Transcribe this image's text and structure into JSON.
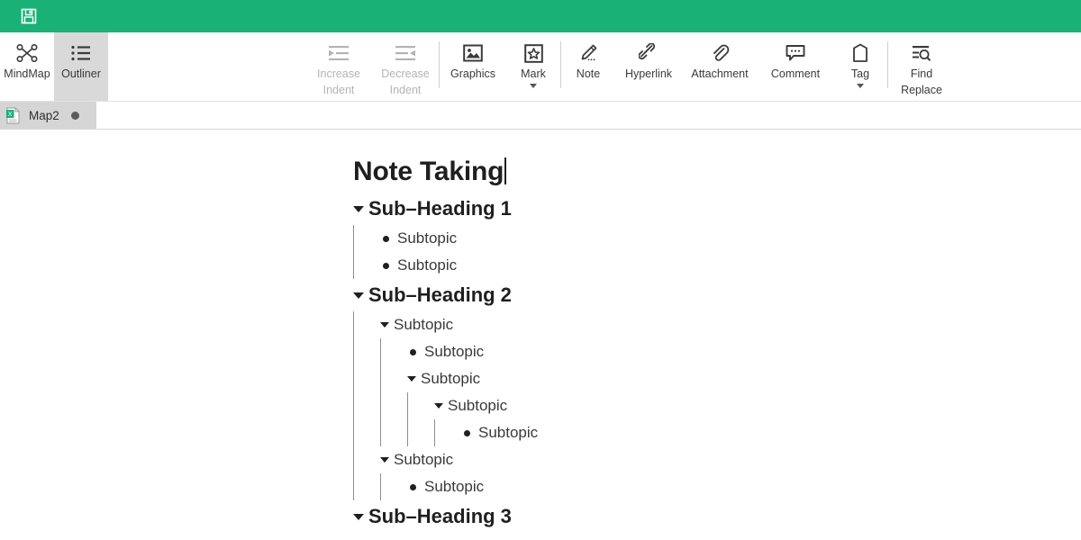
{
  "titlebar": {
    "save_label": "Save",
    "save_icon": "floppy-disk-icon",
    "background_color": "#1ab176"
  },
  "toolbar": {
    "view_buttons": [
      {
        "label": "MindMap",
        "icon": "mindmap-icon",
        "selected": false,
        "disabled": false
      },
      {
        "label": "Outliner",
        "icon": "outliner-list-icon",
        "selected": true,
        "disabled": false
      }
    ],
    "indent_buttons": [
      {
        "label_line1": "Increase",
        "label_line2": "Indent",
        "icon": "increase-indent-icon",
        "disabled": true
      },
      {
        "label_line1": "Decrease",
        "label_line2": "Indent",
        "icon": "decrease-indent-icon",
        "disabled": true
      }
    ],
    "insert_buttons": [
      {
        "label": "Graphics",
        "icon": "image-icon",
        "has_dropdown": false
      },
      {
        "label": "Mark",
        "icon": "star-badge-icon",
        "has_dropdown": true
      }
    ],
    "annotate_buttons": [
      {
        "label": "Note",
        "icon": "pencil-note-icon",
        "has_dropdown": false
      },
      {
        "label": "Hyperlink",
        "icon": "link-chain-icon",
        "has_dropdown": false
      },
      {
        "label": "Attachment",
        "icon": "paperclip-icon",
        "has_dropdown": false
      },
      {
        "label": "Comment",
        "icon": "comment-bubble-icon",
        "has_dropdown": false
      },
      {
        "label": "Tag",
        "icon": "tag-icon",
        "has_dropdown": true
      }
    ],
    "find_button": {
      "label_line1": "Find",
      "label_line2": "Replace",
      "icon": "find-replace-icon"
    },
    "selected_background": "#d9d9d9",
    "disabled_color": "#b4b4b4"
  },
  "tabbar": {
    "tabs": [
      {
        "title": "Map2",
        "icon": "map-document-icon",
        "modified": true,
        "active": true
      }
    ]
  },
  "outline": {
    "title": "Note Taking",
    "cursor_visible": true,
    "nodes": [
      {
        "level": 1,
        "marker": "twisty",
        "text": "Sub–Heading 1",
        "style": "heading"
      },
      {
        "level": 2,
        "marker": "bullet",
        "text": "Subtopic",
        "style": "topic"
      },
      {
        "level": 2,
        "marker": "bullet",
        "text": "Subtopic",
        "style": "topic"
      },
      {
        "level": 1,
        "marker": "twisty",
        "text": "Sub–Heading 2",
        "style": "heading"
      },
      {
        "level": 2,
        "marker": "twisty",
        "text": "Subtopic",
        "style": "topic"
      },
      {
        "level": 3,
        "marker": "bullet",
        "text": "Subtopic",
        "style": "topic"
      },
      {
        "level": 3,
        "marker": "twisty",
        "text": "Subtopic",
        "style": "topic"
      },
      {
        "level": 4,
        "marker": "twisty",
        "text": "Subtopic",
        "style": "topic"
      },
      {
        "level": 5,
        "marker": "bullet",
        "text": "Subtopic",
        "style": "topic"
      },
      {
        "level": 2,
        "marker": "twisty",
        "text": "Subtopic",
        "style": "topic"
      },
      {
        "level": 3,
        "marker": "bullet",
        "text": "Subtopic",
        "style": "topic"
      },
      {
        "level": 1,
        "marker": "twisty",
        "text": "Sub–Heading 3",
        "style": "heading"
      }
    ]
  }
}
